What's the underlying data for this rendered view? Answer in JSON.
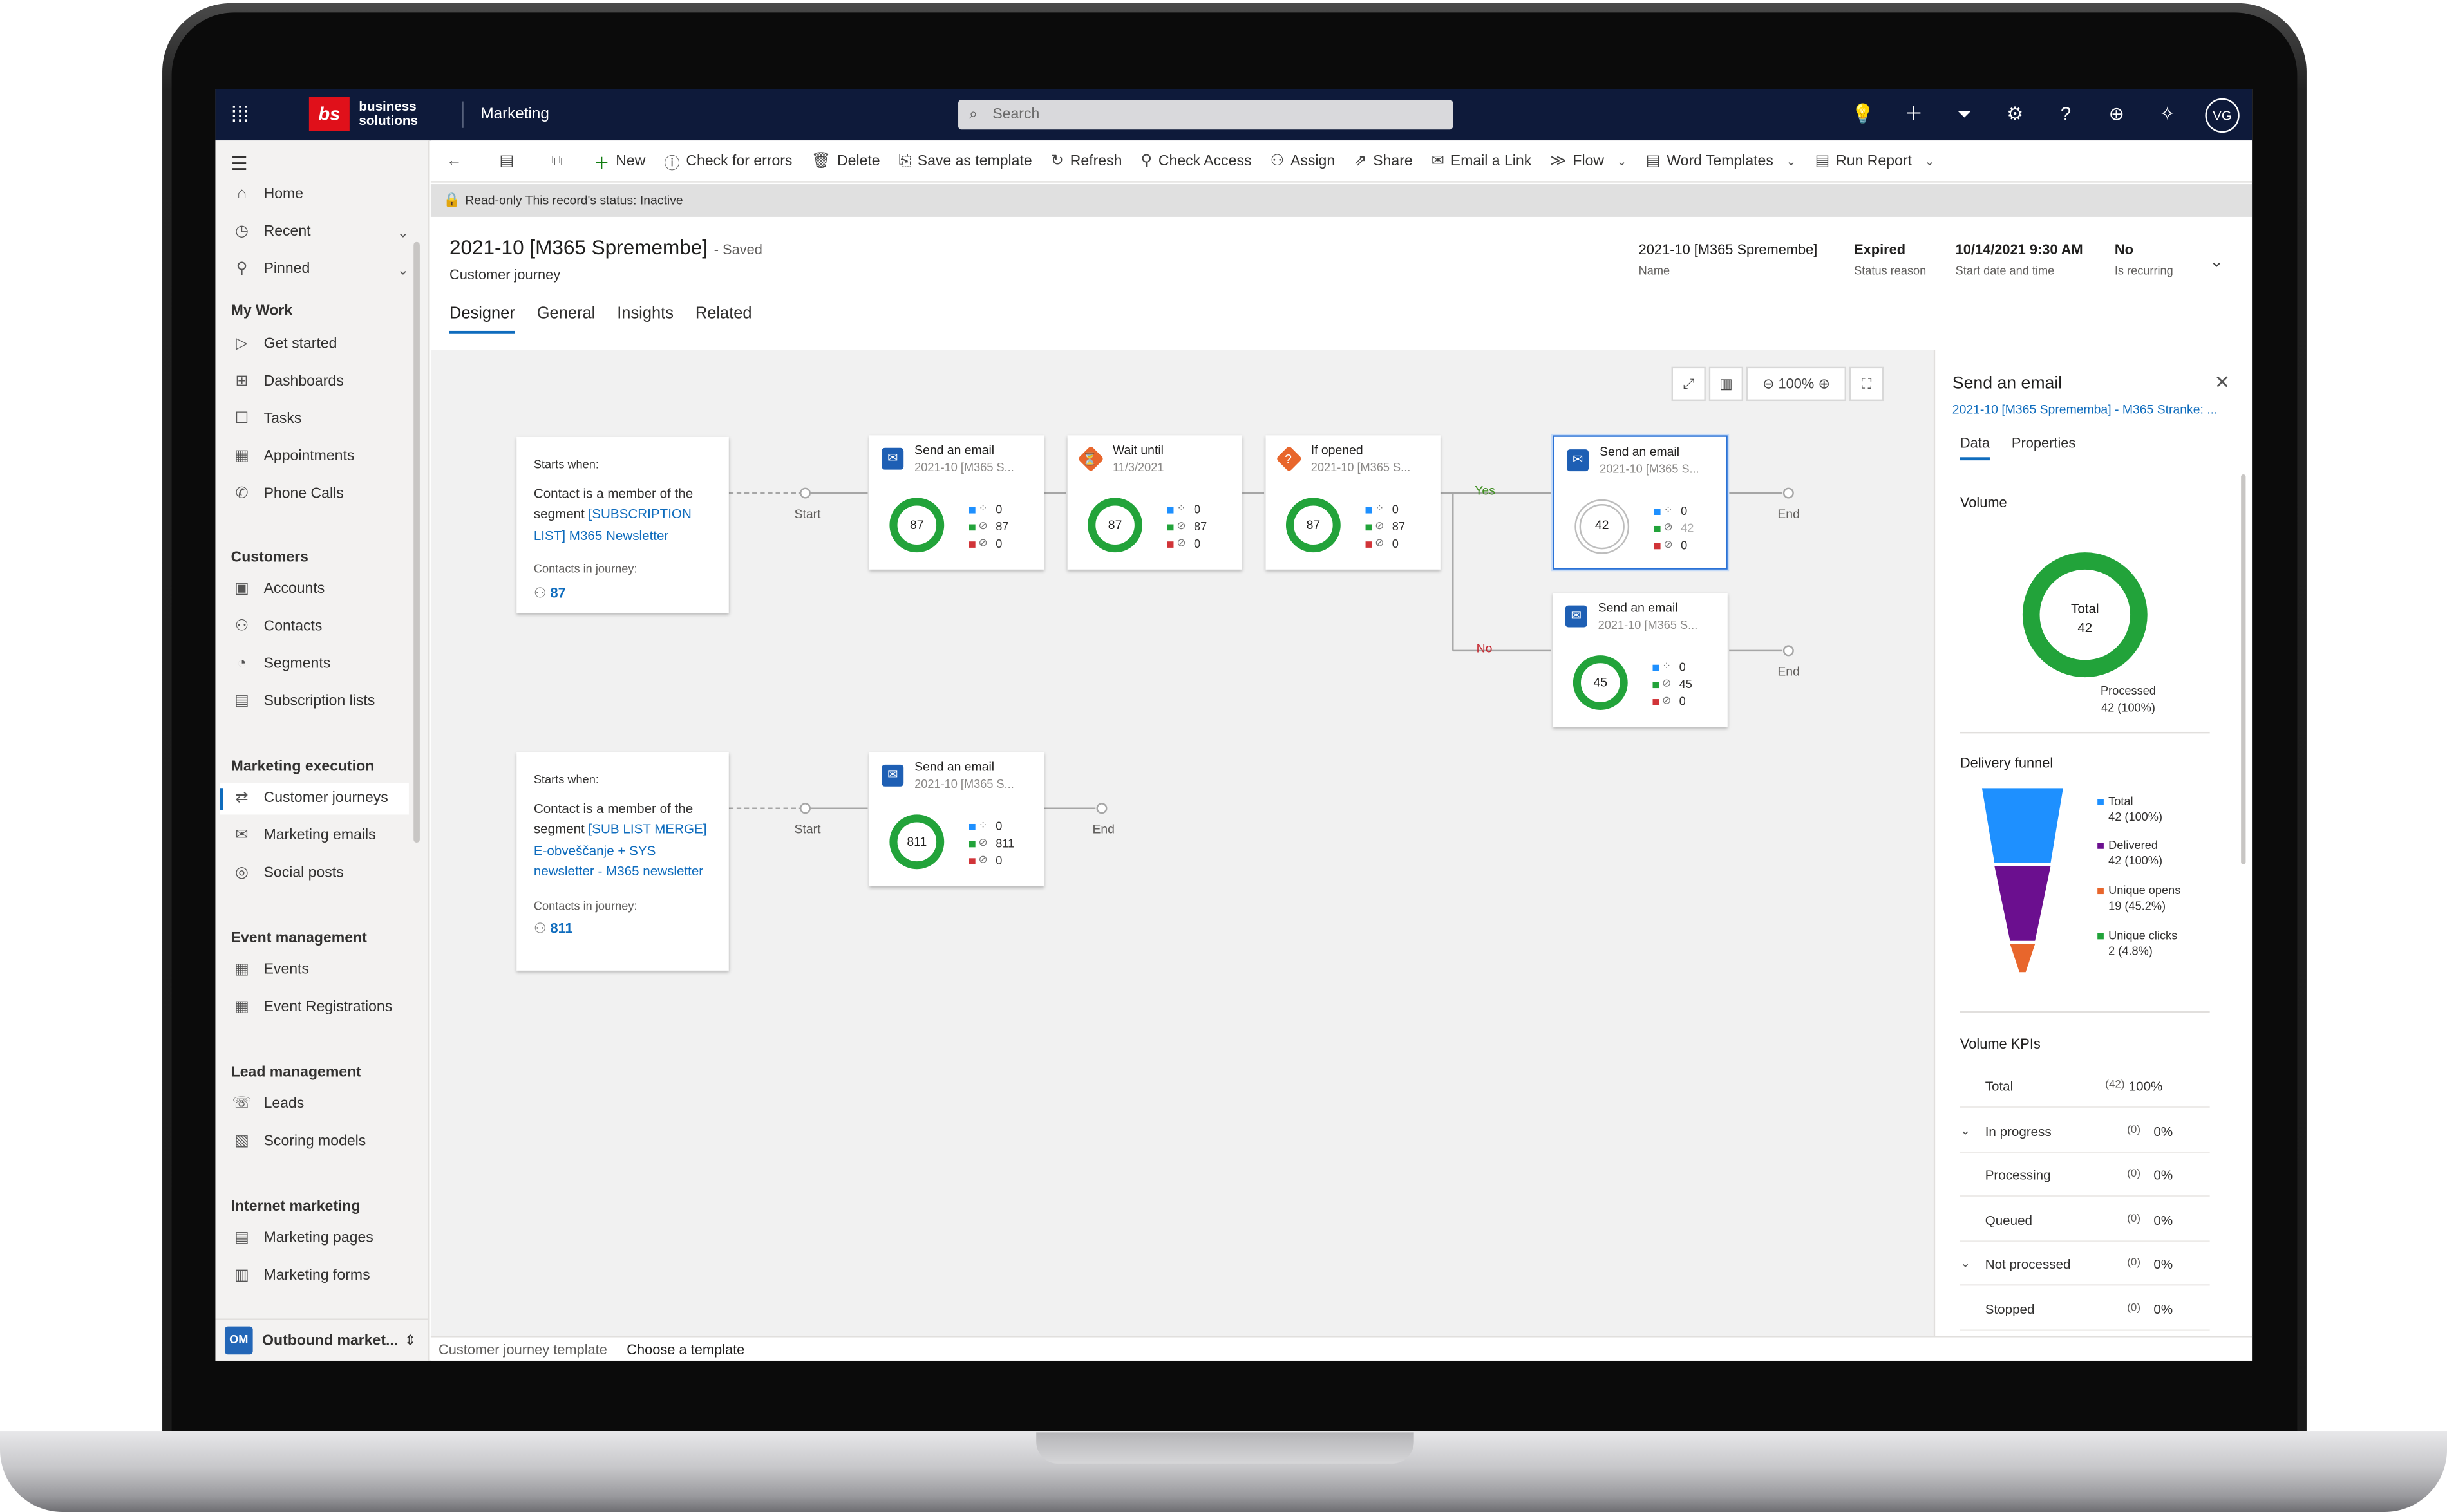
{
  "topbar": {
    "brand_mark": "bs",
    "brand_text_1": "business",
    "brand_text_2": "solutions",
    "app_name": "Marketing",
    "search_placeholder": "Search",
    "user_initials": "VG"
  },
  "sidebar": {
    "items_top": [
      {
        "label": "Home",
        "icon": "home-icon"
      },
      {
        "label": "Recent",
        "icon": "clock-icon"
      },
      {
        "label": "Pinned",
        "icon": "pin-icon"
      }
    ],
    "groups": [
      {
        "title": "My Work",
        "items": [
          "Get started",
          "Dashboards",
          "Tasks",
          "Appointments",
          "Phone Calls"
        ]
      },
      {
        "title": "Customers",
        "items": [
          "Accounts",
          "Contacts",
          "Segments",
          "Subscription lists"
        ]
      },
      {
        "title": "Marketing execution",
        "items": [
          "Customer journeys",
          "Marketing emails",
          "Social posts"
        ]
      },
      {
        "title": "Event management",
        "items": [
          "Events",
          "Event Registrations"
        ]
      },
      {
        "title": "Lead management",
        "items": [
          "Leads",
          "Scoring models"
        ]
      },
      {
        "title": "Internet marketing",
        "items": [
          "Marketing pages",
          "Marketing forms"
        ]
      }
    ],
    "active_item": "Customer journeys",
    "area_badge": "OM",
    "area_label": "Outbound market..."
  },
  "commands": [
    "New",
    "Check for errors",
    "Delete",
    "Save as template",
    "Refresh",
    "Check Access",
    "Assign",
    "Share",
    "Email a Link",
    "Flow",
    "Word Templates",
    "Run Report"
  ],
  "notice": "Read-only This record's status: Inactive",
  "record": {
    "title": "2021-10 [M365 Spremembe]",
    "saved": "- Saved",
    "entity": "Customer journey",
    "fields": [
      {
        "value": "2021-10 [M365 Spremembe]",
        "label": "Name"
      },
      {
        "value": "Expired",
        "label": "Status reason"
      },
      {
        "value": "10/14/2021 9:30 AM",
        "label": "Start date and time"
      },
      {
        "value": "No",
        "label": "Is recurring"
      }
    ],
    "tabs": [
      "Designer",
      "General",
      "Insights",
      "Related"
    ]
  },
  "zoom": "100%",
  "journey": {
    "trigger1": {
      "starts": "Starts when:",
      "text": "Contact is a member of the segment ",
      "link": "[SUBSCRIPTION LIST] M365 Newsletter",
      "cij": "Contacts in journey:",
      "count": "87"
    },
    "trigger2": {
      "starts": "Starts when:",
      "text": "Contact is a member of the segment ",
      "link": "[SUB LIST MERGE] E-obveščanje + SYS newsletter - M365 newsletter",
      "cij": "Contacts in journey:",
      "count": "811"
    },
    "labels": {
      "start": "Start",
      "end": "End",
      "yes": "Yes",
      "no": "No"
    },
    "tiles": [
      {
        "title": "Send an email",
        "sub": "2021-10 [M365 S...",
        "ring": "87",
        "s": [
          "0",
          "87",
          "0"
        ]
      },
      {
        "title": "Wait until",
        "sub": "11/3/2021",
        "ring": "87",
        "s": [
          "0",
          "87",
          "0"
        ]
      },
      {
        "title": "If opened",
        "sub": "2021-10 [M365 S...",
        "ring": "87",
        "s": [
          "0",
          "87",
          "0"
        ]
      },
      {
        "title": "Send an email",
        "sub": "2021-10 [M365 S...",
        "ring": "42",
        "s": [
          "0",
          "42",
          "0"
        ]
      },
      {
        "title": "Send an email",
        "sub": "2021-10 [M365 S...",
        "ring": "45",
        "s": [
          "0",
          "45",
          "0"
        ]
      },
      {
        "title": "Send an email",
        "sub": "2021-10 [M365 S...",
        "ring": "811",
        "s": [
          "0",
          "811",
          "0"
        ]
      }
    ]
  },
  "panel": {
    "title": "Send an email",
    "subtitle": "2021-10 [M365 Sprememba] - M365 Stranke: ...",
    "tabs": [
      "Data",
      "Properties"
    ],
    "volume": "Volume",
    "total_label": "Total",
    "total_value": "42",
    "processed_label": "Processed",
    "processed_value": "42 (100%)",
    "funnel_title": "Delivery funnel",
    "funnel": [
      {
        "name": "Total",
        "value": "42 (100%)",
        "color": "#1e90ff"
      },
      {
        "name": "Delivered",
        "value": "42 (100%)",
        "color": "#6b0f8f"
      },
      {
        "name": "Unique opens",
        "value": "19 (45.2%)",
        "color": "#e8662c"
      },
      {
        "name": "Unique clicks",
        "value": "2 (4.8%)",
        "color": "#22a33a"
      }
    ],
    "kpi_title": "Volume KPIs",
    "kpis": [
      {
        "label": "Total",
        "count": "(42)",
        "pct": "100%"
      },
      {
        "label": "In progress",
        "count": "(0)",
        "pct": "0%"
      },
      {
        "label": "Processing",
        "count": "(0)",
        "pct": "0%"
      },
      {
        "label": "Queued",
        "count": "(0)",
        "pct": "0%"
      },
      {
        "label": "Not processed",
        "count": "(0)",
        "pct": "0%"
      },
      {
        "label": "Stopped",
        "count": "(0)",
        "pct": "0%"
      }
    ]
  },
  "footer": {
    "label": "Customer journey template",
    "action": "Choose a template"
  }
}
